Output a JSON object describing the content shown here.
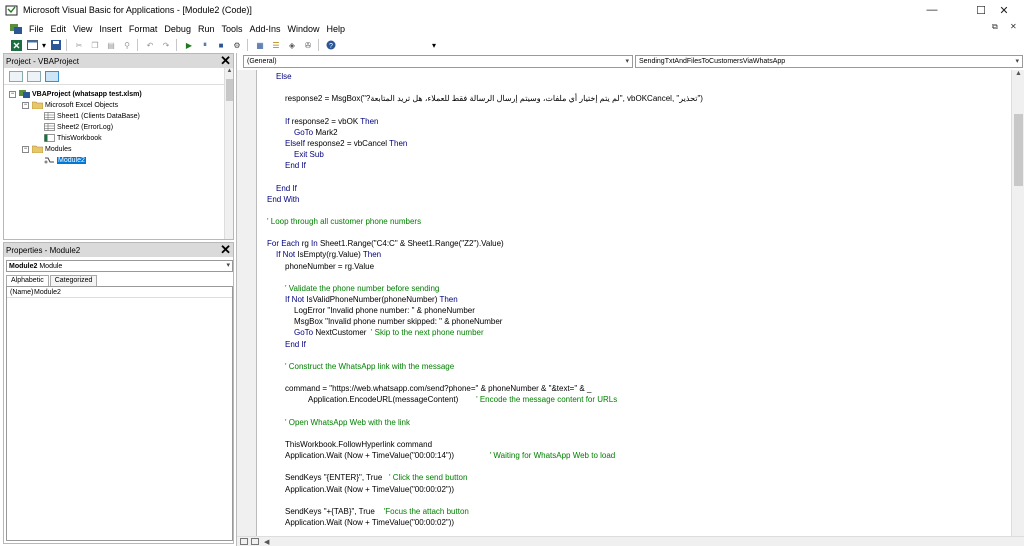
{
  "window": {
    "title": "Microsoft Visual Basic for Applications - [Module2 (Code)]",
    "minimize": "—",
    "maximize": "☐",
    "close": "✕"
  },
  "menu": {
    "items": [
      "File",
      "Edit",
      "View",
      "Insert",
      "Format",
      "Debug",
      "Run",
      "Tools",
      "Add-Ins",
      "Window",
      "Help"
    ],
    "mdi_restore": "⧉",
    "mdi_close": "✕"
  },
  "project": {
    "title": "Project - VBAProject",
    "close": "✕",
    "tree": [
      {
        "label": "VBAProject (whatsapp test.xlsm)",
        "bold": true,
        "twisty": "−"
      },
      {
        "label": "Microsoft Excel Objects",
        "twisty": "−"
      },
      {
        "label": "Sheet1 (Clients DataBase)"
      },
      {
        "label": "Sheet2 (ErrorLog)"
      },
      {
        "label": "ThisWorkbook"
      },
      {
        "label": "Modules",
        "twisty": "−"
      },
      {
        "label": "Module2",
        "selected": true
      }
    ]
  },
  "properties": {
    "title": "Properties - Module2",
    "close": "✕",
    "object_name": "Module2",
    "object_type": "Module",
    "tabs": [
      "Alphabetic",
      "Categorized"
    ],
    "rows": [
      {
        "key": "(Name)",
        "value": "Module2"
      }
    ]
  },
  "code": {
    "object_combo": "(General)",
    "proc_combo": "SendingTxtAndFilesToCustomersViaWhatsApp",
    "lines": [
      {
        "segs": [
          {
            "t": "Else",
            "c": "kw"
          }
        ]
      },
      {
        "segs": []
      },
      {
        "segs": [
          {
            "t": "response2 = MsgBox(\"?",
            "c": ""
          },
          {
            "t": "لم يتم إختيار أي ملفات، وسيتم إرسال الرسالة فقط للعملاء، هل تريد المتابعة",
            "c": ""
          },
          {
            "t": "\", vbOKCancel, \"",
            "c": ""
          },
          {
            "t": "تحذير",
            "c": ""
          },
          {
            "t": "\")",
            "c": ""
          }
        ]
      },
      {
        "segs": []
      },
      {
        "segs": [
          {
            "t": "If ",
            "c": "kw"
          },
          {
            "t": "response2 = vbOK ",
            "c": ""
          },
          {
            "t": "Then",
            "c": "kw"
          }
        ]
      },
      {
        "segs": [
          {
            "t": "GoTo ",
            "c": "kw"
          },
          {
            "t": "Mark2",
            "c": ""
          }
        ]
      },
      {
        "segs": [
          {
            "t": "ElseIf ",
            "c": "kw"
          },
          {
            "t": "response2 = vbCancel ",
            "c": ""
          },
          {
            "t": "Then",
            "c": "kw"
          }
        ]
      },
      {
        "segs": [
          {
            "t": "Exit Sub",
            "c": "kw"
          }
        ]
      },
      {
        "segs": [
          {
            "t": "End If",
            "c": "kw"
          }
        ]
      },
      {
        "segs": []
      },
      {
        "segs": [
          {
            "t": "End If",
            "c": "kw"
          }
        ]
      },
      {
        "segs": [
          {
            "t": "End With",
            "c": "kw"
          }
        ]
      },
      {
        "segs": []
      },
      {
        "segs": [
          {
            "t": "' Loop through all customer phone numbers",
            "c": "cm"
          }
        ]
      },
      {
        "segs": []
      },
      {
        "segs": [
          {
            "t": "For Each ",
            "c": "kw"
          },
          {
            "t": "rg ",
            "c": ""
          },
          {
            "t": "In ",
            "c": "kw"
          },
          {
            "t": "Sheet1.Range(\"C4:C\" & Sheet1.Range(\"Z2\").Value)",
            "c": ""
          }
        ]
      },
      {
        "segs": [
          {
            "t": "If Not ",
            "c": "kw"
          },
          {
            "t": "IsEmpty(rg.Value) ",
            "c": ""
          },
          {
            "t": "Then",
            "c": "kw"
          }
        ]
      },
      {
        "segs": [
          {
            "t": "phoneNumber = rg.Value",
            "c": ""
          }
        ]
      },
      {
        "segs": []
      },
      {
        "segs": [
          {
            "t": "' Validate the phone number before sending",
            "c": "cm"
          }
        ]
      },
      {
        "segs": [
          {
            "t": "If Not ",
            "c": "kw"
          },
          {
            "t": "IsValidPhoneNumber(phoneNumber) ",
            "c": ""
          },
          {
            "t": "Then",
            "c": "kw"
          }
        ]
      },
      {
        "segs": [
          {
            "t": "LogError \"Invalid phone number: \" & phoneNumber",
            "c": ""
          }
        ]
      },
      {
        "segs": [
          {
            "t": "MsgBox \"Invalid phone number skipped: \" & phoneNumber",
            "c": ""
          }
        ]
      },
      {
        "segs": [
          {
            "t": "GoTo ",
            "c": "kw"
          },
          {
            "t": "NextCustomer  ",
            "c": ""
          },
          {
            "t": "' Skip to the next phone number",
            "c": "cm"
          }
        ]
      },
      {
        "segs": [
          {
            "t": "End If",
            "c": "kw"
          }
        ]
      },
      {
        "segs": []
      },
      {
        "segs": [
          {
            "t": "' Construct the WhatsApp link with the message",
            "c": "cm"
          }
        ]
      },
      {
        "segs": []
      },
      {
        "segs": [
          {
            "t": "command = \"https://web.whatsapp.com/send?phone=\" & phoneNumber & \"&text=\" & _",
            "c": ""
          }
        ]
      },
      {
        "segs": [
          {
            "t": "Application.EncodeURL(messageContent)        ",
            "c": ""
          },
          {
            "t": "' Encode the message content for URLs",
            "c": "cm"
          }
        ]
      },
      {
        "segs": []
      },
      {
        "segs": [
          {
            "t": "' Open WhatsApp Web with the link",
            "c": "cm"
          }
        ]
      },
      {
        "segs": []
      },
      {
        "segs": [
          {
            "t": "ThisWorkbook.FollowHyperlink command",
            "c": ""
          }
        ]
      },
      {
        "segs": [
          {
            "t": "Application.Wait (Now + TimeValue(\"00:00:14\"))",
            "c": ""
          },
          {
            "t": "                ' Waiting for WhatsApp Web to load",
            "c": "cm"
          }
        ]
      },
      {
        "segs": []
      },
      {
        "segs": [
          {
            "t": "SendKeys \"{ENTER}\", True   ",
            "c": ""
          },
          {
            "t": "' Click the send button",
            "c": "cm"
          }
        ]
      },
      {
        "segs": [
          {
            "t": "Application.Wait (Now + TimeValue(\"00:00:02\"))",
            "c": ""
          }
        ]
      },
      {
        "segs": []
      },
      {
        "segs": [
          {
            "t": "SendKeys \"+{TAB}\", True    ",
            "c": ""
          },
          {
            "t": "'Focus the attach button",
            "c": "cm"
          }
        ]
      },
      {
        "segs": [
          {
            "t": "Application.Wait (Now + TimeValue(\"00:00:02\"))",
            "c": ""
          }
        ]
      }
    ]
  }
}
